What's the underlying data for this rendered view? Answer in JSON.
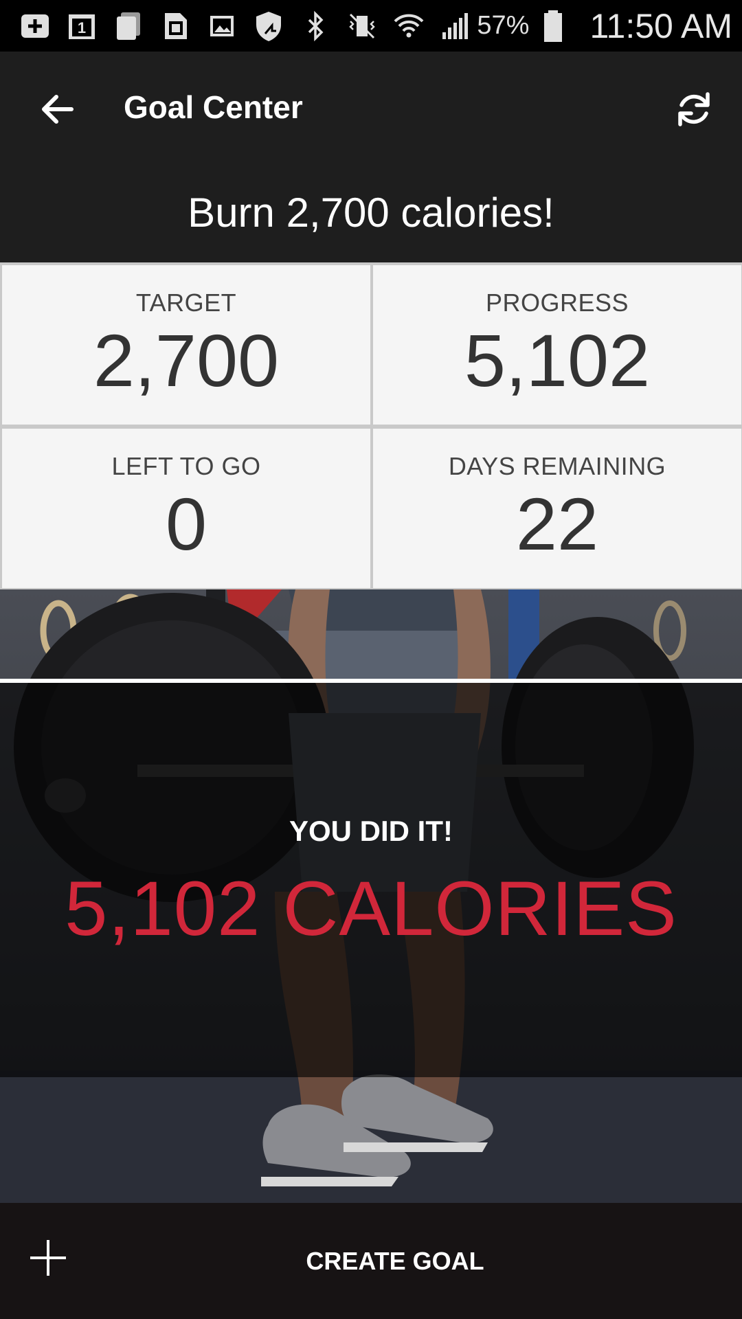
{
  "status_bar": {
    "icons": [
      "add-box-icon",
      "calendar-icon",
      "copy-icon",
      "sd-card-icon",
      "image-icon",
      "shield-icon",
      "bluetooth-icon",
      "vibrate-icon",
      "wifi-icon",
      "signal-icon",
      "battery-icon"
    ],
    "battery_percent": "57%",
    "time": "11:50 AM"
  },
  "app_bar": {
    "title": "Goal Center",
    "back_icon": "arrow-left-icon",
    "refresh_icon": "refresh-icon"
  },
  "goal": {
    "title": "Burn 2,700 calories!",
    "stats": [
      {
        "label": "TARGET",
        "value": "2,700"
      },
      {
        "label": "PROGRESS",
        "value": "5,102"
      },
      {
        "label": "LEFT TO GO",
        "value": "0"
      },
      {
        "label": "DAYS REMAINING",
        "value": "22"
      }
    ]
  },
  "achievement": {
    "headline": "YOU DID IT!",
    "total": "5,102 CALORIES",
    "accent_color": "#d1273a"
  },
  "bottom_bar": {
    "add_icon": "plus-icon",
    "create_label": "CREATE GOAL"
  }
}
